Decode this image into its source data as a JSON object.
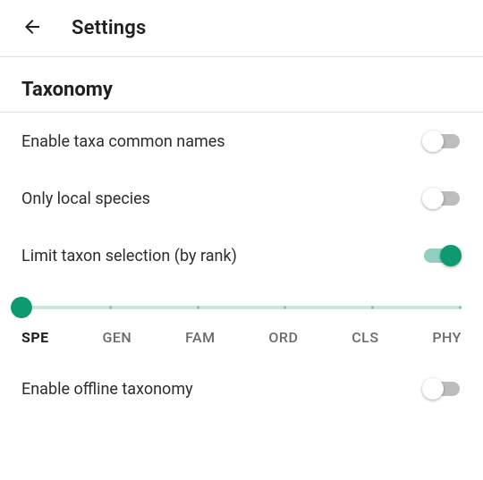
{
  "appbar": {
    "title": "Settings"
  },
  "section": {
    "heading": "Taxonomy"
  },
  "settings": {
    "common_names": {
      "label": "Enable taxa common names",
      "checked": false
    },
    "local_species": {
      "label": "Only local species",
      "checked": false
    },
    "limit_rank": {
      "label": "Limit taxon selection (by rank)",
      "checked": true
    },
    "offline_taxonomy": {
      "label": "Enable offline taxonomy",
      "checked": false
    }
  },
  "rank_slider": {
    "value_index": 0,
    "options": [
      "SPE",
      "GEN",
      "FAM",
      "ORD",
      "CLS",
      "PHY"
    ]
  },
  "colors": {
    "accent": "#0f9971",
    "accent_light": "#8fd1be",
    "switch_off_track": "#bdbdbd"
  }
}
